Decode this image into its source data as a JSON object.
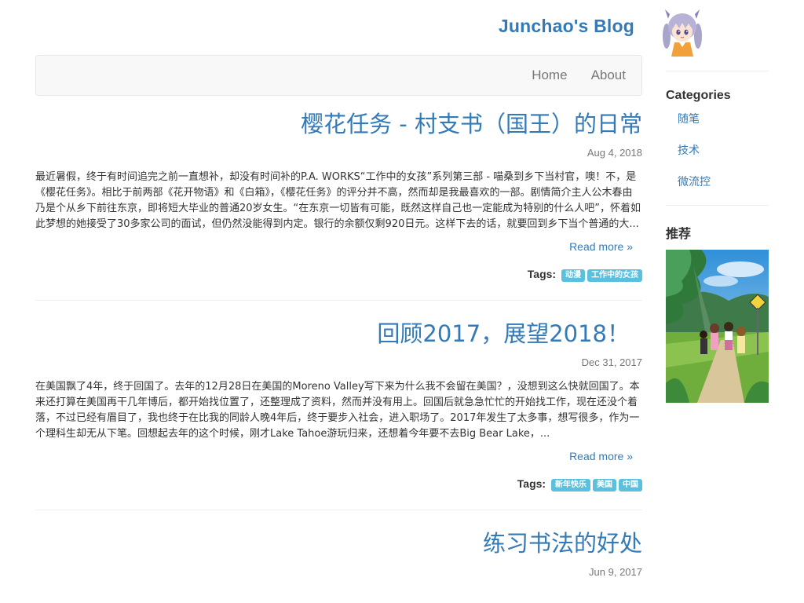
{
  "site": {
    "title": "Junchao's Blog"
  },
  "nav": {
    "items": [
      "Home",
      "About"
    ]
  },
  "posts": [
    {
      "title": "樱花任务 - 村支书（国王）的日常",
      "date": "Aug 4, 2018",
      "excerpt": "最近暑假，终于有时间追完之前一直想补，却没有时间补的P.A. WORKS“工作中的女孩”系列第三部 - 喵桑到乡下当村官，噢！不，是《樱花任务》。相比于前两部《花开物语》和《白箱》，《樱花任务》的评分并不高，然而却是我最喜欢的一部。剧情简介主人公木春由乃是个从乡下前往东京，即将短大毕业的普通20岁女生。“在东京一切皆有可能，既然这样自己也一定能成为特别的什么人吧”，怀着如此梦想的她接受了30多家公司的面试，但仍然没能得到内定。银行的余额仅剩920日元。这样下去的话，就要回到乡下当个普通的大...",
      "read_more": "Read more »",
      "tags_label": "Tags:",
      "tags": [
        "动漫",
        "工作中的女孩"
      ]
    },
    {
      "title": "回顾2017，展望2018！",
      "date": "Dec 31, 2017",
      "excerpt": "在美国飘了4年，终于回国了。去年的12月28日在美国的Moreno Valley写下来为什么我不会留在美国？，没想到这么快就回国了。本来还打算在美国再干几年博后，都开始找位置了，还整理成了资料，然而并没有用上。回国后就急急忙忙的开始找工作，现在还没个着落，不过已经有眉目了，我也终于在比我的同龄人晚4年后，终于要步入社会，进入职场了。2017年发生了太多事，想写很多，作为一个理科生却无从下笔。回想起去年的这个时候，刚才Lake Tahoe游玩归来，还想着今年要不去Big Bear Lake，...",
      "read_more": "Read more »",
      "tags_label": "Tags:",
      "tags": [
        "新年快乐",
        "美国",
        "中国"
      ]
    },
    {
      "title": "练习书法的好处",
      "date": "Jun 9, 2017"
    }
  ],
  "sidebar": {
    "categories_heading": "Categories",
    "categories": [
      "随笔",
      "技术",
      "微流控"
    ],
    "recommend_heading": "推荐"
  }
}
